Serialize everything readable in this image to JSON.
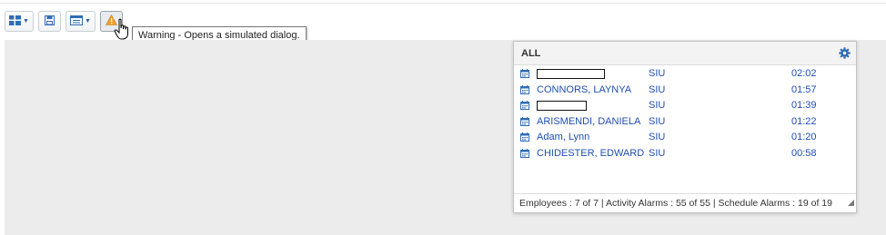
{
  "toolbar": {
    "buttons": [
      {
        "icon": "layout-grid-icon",
        "has_dropdown": true
      },
      {
        "icon": "save-icon",
        "has_dropdown": false
      },
      {
        "icon": "screen-layout-icon",
        "has_dropdown": true
      },
      {
        "icon": "warning-icon",
        "has_dropdown": false
      }
    ]
  },
  "tooltip": {
    "text": "Warning - Opens a simulated dialog."
  },
  "panel": {
    "title": "ALL",
    "rows": [
      {
        "name": "",
        "redacted": true,
        "code": "SIU",
        "time": "02:02"
      },
      {
        "name": "CONNORS, LAYNYA",
        "code": "SIU",
        "time": "01:57"
      },
      {
        "name": "",
        "redacted": true,
        "code": "SIU",
        "time": "01:39"
      },
      {
        "name": "ARISMENDI, DANIELA",
        "code": "SIU",
        "time": "01:22"
      },
      {
        "name": "Adam, Lynn",
        "code": "SIU",
        "time": "01:20"
      },
      {
        "name": "CHIDESTER, EDWARD",
        "code": "SIU",
        "time": "00:58"
      }
    ],
    "footer": "Employees : 7 of 7 | Activity Alarms : 55 of 55 | Schedule Alarms : 19 of 19"
  },
  "colors": {
    "link": "#1f4eb4",
    "accent": "#2f6db5",
    "warning": "#f0a030",
    "workspace": "#ececec"
  }
}
